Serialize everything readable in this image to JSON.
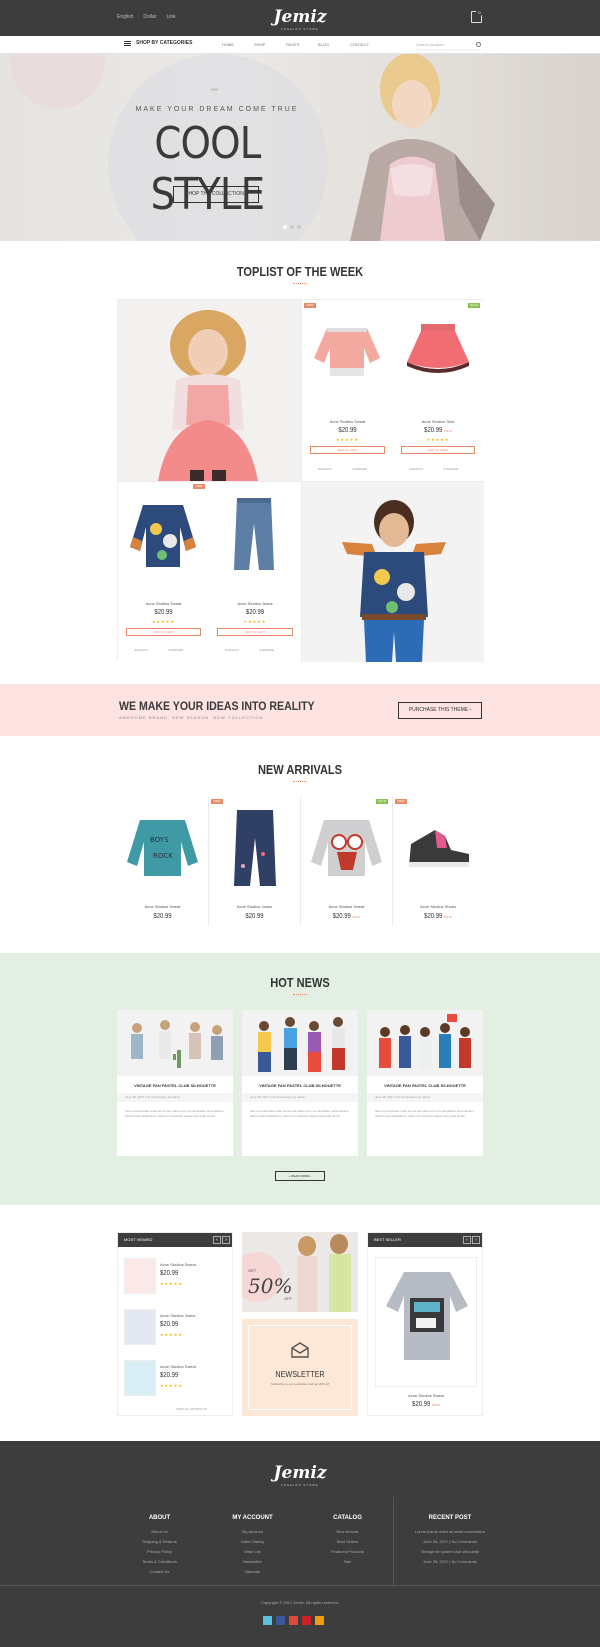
{
  "topbar": {
    "links": [
      "English",
      "Dollar",
      "Link"
    ],
    "logo": "Jemiz",
    "logo_sub": "FASHION STORE",
    "cart_count": "0"
  },
  "nav": {
    "categories_label": "SHOP BY CATEGORIES",
    "menu": [
      "HOME",
      "SHOP",
      "PAGES",
      "BLOG",
      "CONTACT"
    ],
    "search_placeholder": "Search product..."
  },
  "hero": {
    "tagline": "MAKE YOUR DREAM COME TRUE",
    "headline": "COOL STYLE",
    "button": "SHOP THE COLLECTION",
    "slides": 3,
    "active_slide": 1
  },
  "toplist": {
    "title": "TOPLIST OF THE WEEK",
    "products": [
      {
        "name": "Acne Studios Sweat",
        "price": "$20.99",
        "old": "",
        "badge": "NEW",
        "badge_color": "#e88a67",
        "add": "ADD TO CART",
        "wishlist": "WISHLIST",
        "compare": "COMPARE",
        "rating": 5
      },
      {
        "name": "Acne Studios Skirt",
        "price": "$20.99",
        "old": "$29.00",
        "badge": "SALE",
        "badge_color": "#8cc152",
        "add": "ADD TO CART",
        "wishlist": "WISHLIST",
        "compare": "COMPARE",
        "rating": 5
      },
      {
        "name": "Acne Studios Sweat",
        "price": "$20.99",
        "old": "",
        "badge": "NEW",
        "badge_color": "#e88a67",
        "add": "ADD TO CART",
        "wishlist": "WISHLIST",
        "compare": "COMPARE",
        "rating": 5
      },
      {
        "name": "Acne Studios Jeans",
        "price": "$20.99",
        "old": "",
        "badge": "",
        "badge_color": "",
        "add": "ADD TO CART",
        "wishlist": "WISHLIST",
        "compare": "COMPARE",
        "rating": 5
      }
    ]
  },
  "banner": {
    "headline": "WE MAKE YOUR IDEAS INTO REALITY",
    "sub": "AWESOME BRAND. NEW SEASON. NEW COLLECTION.",
    "button": "PURCHASE THIS THEME"
  },
  "arrivals": {
    "title": "NEW ARRIVALS",
    "products": [
      {
        "name": "Acne Studios Sweat",
        "price": "$20.99",
        "old": "",
        "badge": "",
        "badge_color": ""
      },
      {
        "name": "Acne Studios Jeans",
        "price": "$20.99",
        "old": "",
        "badge": "NEW",
        "badge_color": "#e88a67"
      },
      {
        "name": "Acne Studios Sweat",
        "price": "$20.99",
        "old": "$29.00",
        "badge": "SALE",
        "badge_color": "#8cc152"
      },
      {
        "name": "Acne Studios Shoes",
        "price": "$20.99",
        "old": "$29.00",
        "badge": "NEW",
        "badge_color": "#e88a67"
      }
    ]
  },
  "news": {
    "title": "HOT NEWS",
    "posts": [
      {
        "title": "VINTAGE FAN PASTEL CLUB SILHOUETTE",
        "meta": "June 28, 2017   |   No Comments   |   by admin",
        "text": "Sed ut perspiciatis unde omnis iste natus error sit voluptatem accusantium doloremque laudantium, totam rem aperiam eaque ipsa quae ab illo."
      },
      {
        "title": "VINTAGE FAN PASTEL CLUB SILHOUETTE",
        "meta": "June 28, 2017   |   No Comments   |   by admin",
        "text": "Sed ut perspiciatis unde omnis iste natus error sit voluptatem accusantium doloremque laudantium, totam rem aperiam eaque ipsa quae ab illo."
      },
      {
        "title": "VINTAGE FAN PASTEL CLUB SILHOUETTE",
        "meta": "June 28, 2017   |   No Comments   |   by admin",
        "text": "Sed ut perspiciatis unde omnis iste natus error sit voluptatem accusantium doloremque laudantium, totam rem aperiam eaque ipsa quae ab illo."
      }
    ],
    "read_more": "READ MORE"
  },
  "widgets": {
    "most_viewed": {
      "title": "MOST VIEWED",
      "items": [
        {
          "name": "Acne Studios Sweat",
          "price": "$20.99"
        },
        {
          "name": "Acne Studios Jeans",
          "price": "$20.99"
        },
        {
          "name": "Acne Studios Sweat",
          "price": "$20.99"
        }
      ],
      "view_all": "VIEW ALL PRODUCTS"
    },
    "promo": {
      "text": "50%",
      "prefix": "GET",
      "suffix": "OFF"
    },
    "newsletter": {
      "title": "NEWSLETTER",
      "sub": "Subscribe to our newsletter and get 20% off"
    },
    "best_seller": {
      "title": "BEST SELLER",
      "name": "Acne Studios Sweat",
      "price": "$20.99",
      "old": "$29.00"
    }
  },
  "footer": {
    "logo": "Jemiz",
    "logo_sub": "FASHION STORE",
    "about": {
      "title": "ABOUT",
      "links": [
        "About Us",
        "Shipping & Returns",
        "Privacy Policy",
        "Terms & Conditions",
        "Contact Us"
      ]
    },
    "account": {
      "title": "MY ACCOUNT",
      "links": [
        "My Account",
        "Order History",
        "Wish List",
        "Newsletter",
        "Specials"
      ]
    },
    "catalog": {
      "title": "CATALOG",
      "links": [
        "New Arrivals",
        "Best Sellers",
        "Featured Products",
        "Sale"
      ]
    },
    "recent": {
      "title": "RECENT POST",
      "posts": [
        "Lorem ipsum dolor sit amet consectetur",
        "June 28, 2017 | No Comments",
        "Vintage fan pastel club silhouette",
        "June 28, 2017 | No Comments"
      ]
    },
    "copyright": "Copyright © 2017 Jemiz. All rights reserved."
  },
  "colors": {
    "accent": "#e88a67",
    "sale": "#8cc152",
    "dark": "#3d3d3d",
    "banner": "#fde3e1",
    "news_bg": "#e3efe3"
  }
}
